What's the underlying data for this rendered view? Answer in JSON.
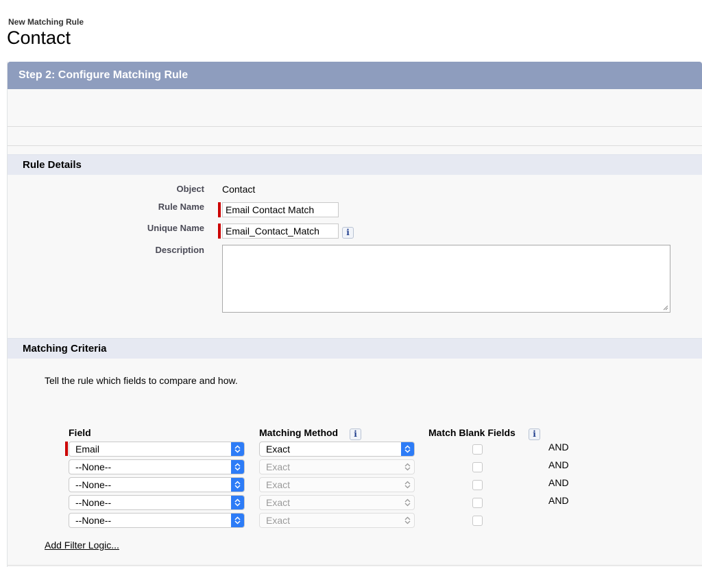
{
  "page": {
    "subtitle": "New Matching Rule",
    "title": "Contact"
  },
  "step": {
    "title": "Step 2: Configure Matching Rule"
  },
  "rule_details": {
    "header": "Rule Details",
    "object_label": "Object",
    "object_value": "Contact",
    "rule_name_label": "Rule Name",
    "rule_name_value": "Email Contact Match",
    "unique_name_label": "Unique Name",
    "unique_name_value": "Email_Contact_Match",
    "description_label": "Description",
    "description_value": ""
  },
  "matching_criteria": {
    "header": "Matching Criteria",
    "help_text": "Tell the rule which fields to compare and how.",
    "col_field": "Field",
    "col_method": "Matching Method",
    "col_blank": "Match Blank Fields",
    "rows": [
      {
        "field": "Email",
        "method": "Exact",
        "blank": false,
        "connector": "AND"
      },
      {
        "field": "--None--",
        "method": "Exact",
        "blank": false,
        "connector": "AND"
      },
      {
        "field": "--None--",
        "method": "Exact",
        "blank": false,
        "connector": "AND"
      },
      {
        "field": "--None--",
        "method": "Exact",
        "blank": false,
        "connector": "AND"
      },
      {
        "field": "--None--",
        "method": "Exact",
        "blank": false,
        "connector": ""
      }
    ],
    "add_filter_logic": "Add Filter Logic...",
    "info_glyph": "i"
  },
  "colors": {
    "header_bar": "#8e9dbe",
    "section_bar": "#e6e9f2",
    "required": "#cc0000",
    "select_accent": "#2d7cf7"
  },
  "icons": {
    "info": "info-icon",
    "select_arrow": "up-down-chevron-icon",
    "resize": "resize-handle-icon"
  }
}
